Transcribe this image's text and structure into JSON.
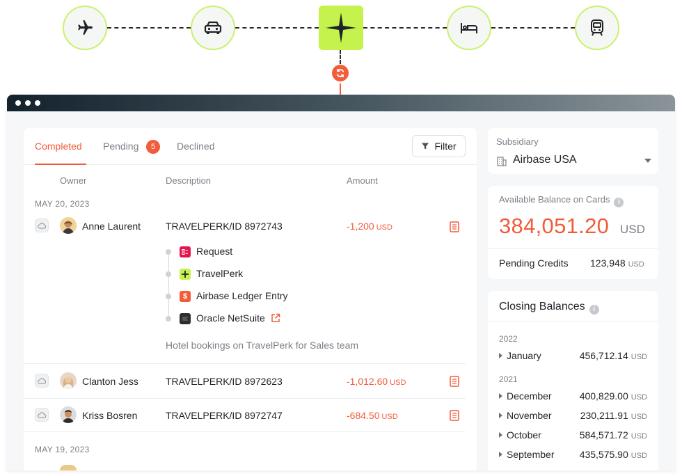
{
  "colors": {
    "accent": "#f25c3a",
    "lime": "#c5f24c",
    "lime_ring": "#c8f26b"
  },
  "flow": {
    "nodes": [
      "airplane-icon",
      "car-icon",
      "travelperk-logo-icon",
      "bed-icon",
      "train-icon"
    ],
    "sync_icon": "sync-icon"
  },
  "window": {
    "dots": 3
  },
  "tabs": {
    "completed": "Completed",
    "pending": "Pending",
    "pending_count": "5",
    "declined": "Declined",
    "filter": "Filter"
  },
  "columns": {
    "owner": "Owner",
    "description": "Description",
    "amount": "Amount"
  },
  "groups": [
    {
      "date": "MAY 20, 2023",
      "rows": [
        {
          "owner": "Anne Laurent",
          "description": "TRAVELPERK/ID 8972743",
          "amount": "-1,200",
          "currency": "USD",
          "steps": [
            "Request",
            "TravelPerk",
            "Airbase Ledger Entry",
            "Oracle NetSuite"
          ],
          "note": "Hotel bookings on TravelPerk for Sales team"
        },
        {
          "owner": "Clanton Jess",
          "description": "TRAVELPERK/ID 8972623",
          "amount": "-1,012.60",
          "currency": "USD"
        },
        {
          "owner": "Kriss Bosren",
          "description": "TRAVELPERK/ID 8972747",
          "amount": "-684.50",
          "currency": "USD"
        }
      ]
    },
    {
      "date": "MAY 19, 2023",
      "rows": []
    }
  ],
  "subsidiary": {
    "label": "Subsidiary",
    "value": "Airbase USA"
  },
  "balance": {
    "label": "Available Balance on Cards",
    "value": "384,051.20",
    "currency": "USD",
    "pending_label": "Pending Credits",
    "pending_value": "123,948",
    "pending_currency": "USD"
  },
  "closing": {
    "title": "Closing Balances",
    "years": [
      {
        "year": "2022",
        "months": [
          {
            "name": "January",
            "value": "456,712.14",
            "currency": "USD"
          }
        ]
      },
      {
        "year": "2021",
        "months": [
          {
            "name": "December",
            "value": "400,829.00",
            "currency": "USD"
          },
          {
            "name": "November",
            "value": "230,211.91",
            "currency": "USD"
          },
          {
            "name": "October",
            "value": "584,571.72",
            "currency": "USD"
          },
          {
            "name": "September",
            "value": "435,575.90",
            "currency": "USD"
          }
        ]
      }
    ]
  }
}
